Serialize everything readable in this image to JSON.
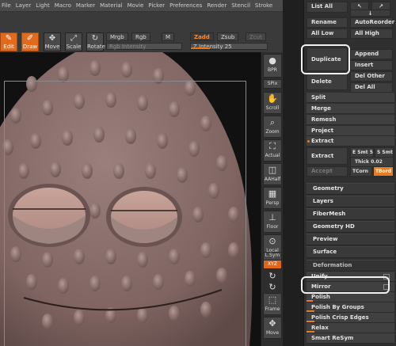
{
  "menubar": [
    "File",
    "Layer",
    "Light",
    "Macro",
    "Marker",
    "Material",
    "Movie",
    "Picker",
    "Preferences",
    "Render",
    "Stencil",
    "Stroke"
  ],
  "toolbar": {
    "edit_label": "Edit",
    "draw_label": "Draw",
    "move_label": "Move",
    "scale_label": "Scale",
    "rotate_label": "Rotate",
    "mrgb_label": "Mrgb",
    "rgb_label": "Rgb",
    "m_label": "M",
    "zadd_label": "Zadd",
    "zsub_label": "Zsub",
    "zcut_label": "Zcut",
    "rgb_intensity_label": "Rgb Intensity",
    "z_intensity_label": "Z Intensity 25",
    "z_intensity_value": 25
  },
  "dock": {
    "bpr": "BPR",
    "spix": "SPix",
    "scroll": "Scroll",
    "zoom": "Zoom",
    "actual": "Actual",
    "aahalf": "AAHalf",
    "persp": "Persp",
    "floor": "Floor",
    "local": "Local",
    "lsym": "L.Sym",
    "xyz": "XYZ",
    "frame": "Frame",
    "move": "Move"
  },
  "panel": {
    "list_all": "List All",
    "rename": "Rename",
    "auto_reorder": "AutoReorder",
    "all_low": "All Low",
    "all_high": "All High",
    "duplicate": "Duplicate",
    "append": "Append",
    "insert": "Insert",
    "delete": "Delete",
    "del_other": "Del Other",
    "del_all": "Del All",
    "split": "Split",
    "merge": "Merge",
    "remesh": "Remesh",
    "project": "Project",
    "extract_head": "Extract",
    "extract_btn": "Extract",
    "e_smt": "E Smt 5",
    "s_smt": "S Smt",
    "thick_label": "Thick",
    "thick_value": "0.02",
    "accept": "Accept",
    "tcorn": "TCorn",
    "tbord": "TBord",
    "geometry": "Geometry",
    "layers": "Layers",
    "fibermesh": "FiberMesh",
    "geometry_hd": "Geometry HD",
    "preview": "Preview",
    "surface": "Surface",
    "deformation": "Deformation",
    "unify": "Unify",
    "mirror": "Mirror",
    "polish": "Polish",
    "polish_by_groups": "Polish By Groups",
    "polish_crisp_edges": "Polish Crisp Edges",
    "relax": "Relax",
    "smart_resym": "Smart ReSym"
  },
  "colors": {
    "accent": "#e67d22",
    "panel_bg": "#2f2f2f",
    "model": "#8e7370"
  }
}
